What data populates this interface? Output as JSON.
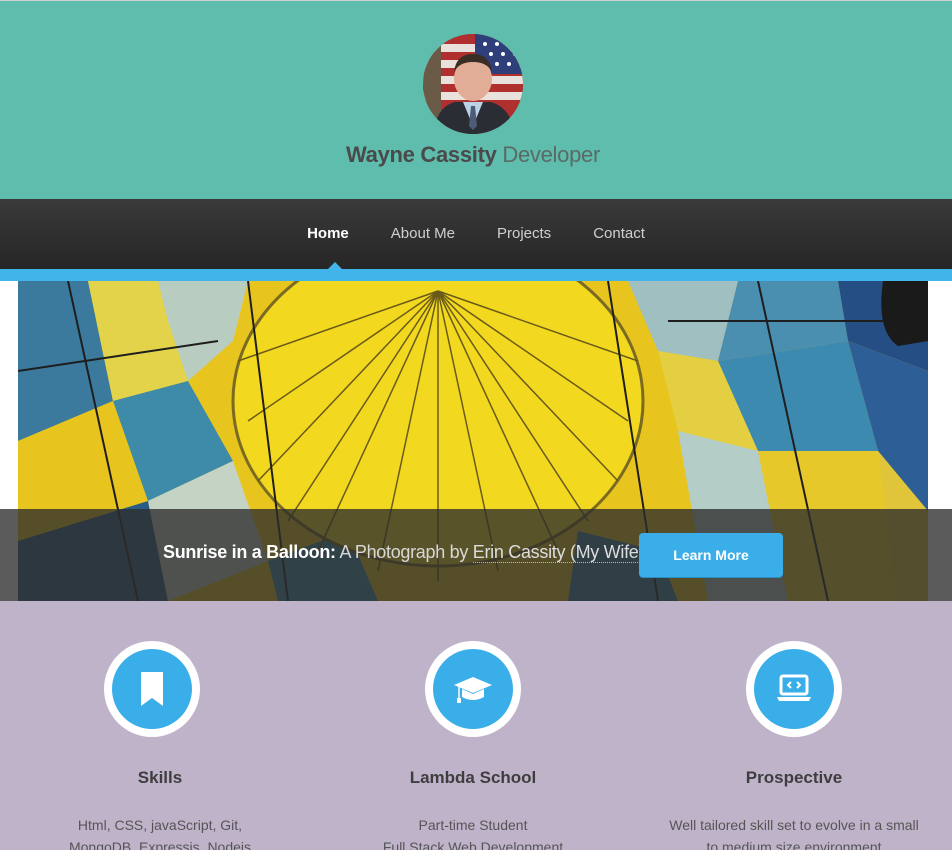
{
  "header": {
    "name": "Wayne Cassity",
    "role": "Developer",
    "avatar_icon": "profile-photo",
    "bg_color": "#5ebdac"
  },
  "nav": {
    "items": [
      {
        "label": "Home",
        "active": true
      },
      {
        "label": "About Me",
        "active": false
      },
      {
        "label": "Projects",
        "active": false
      },
      {
        "label": "Contact",
        "active": false
      }
    ],
    "accent_color": "#41b4ea"
  },
  "banner": {
    "caption_strong": "Sunrise in a Balloon:",
    "caption_text": "A Photograph by",
    "caption_link": "Erin Cassity (My Wife)",
    "button_label": "Learn More"
  },
  "features": [
    {
      "icon": "bookmark-icon",
      "title": "Skills",
      "lines": [
        "Html, CSS, javaScript, Git,",
        "MongoDB, Expressjs, Nodejs"
      ]
    },
    {
      "icon": "graduation-cap-icon",
      "title": "Lambda School",
      "lines": [
        "Part-time Student",
        "Full Stack Web Development"
      ]
    },
    {
      "icon": "laptop-code-icon",
      "title": "Prospective",
      "lines": [
        "Well tailored skill set to evolve in a small",
        "to medium size environment"
      ]
    }
  ],
  "colors": {
    "features_bg": "#bfb3ca",
    "icon_blue": "#3aaee8",
    "nav_bg": "#2e2e2e"
  }
}
